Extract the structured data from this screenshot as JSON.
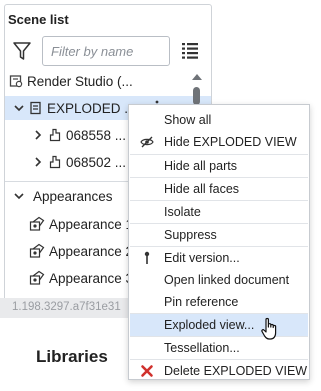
{
  "scene_list": {
    "title": "Scene list",
    "filter_placeholder": "Filter by name",
    "items": [
      {
        "label": "Render Studio (...",
        "icon": "render-studio-icon",
        "level": 0
      },
      {
        "label": "EXPLODED ...",
        "icon": "exploded-view-icon",
        "level": 0,
        "selected": true,
        "expanded": true
      },
      {
        "label": "068558 ...",
        "icon": "part-icon",
        "level": 1
      },
      {
        "label": "068502 ...",
        "icon": "part-icon",
        "level": 1
      }
    ]
  },
  "appearances": {
    "title": "Appearances",
    "items": [
      "Appearance 1",
      "Appearance 2",
      "Appearance 3"
    ]
  },
  "version_text": "1.198.3297.a7f31e31",
  "libraries_title": "Libraries",
  "context_menu": {
    "items": [
      {
        "label": "Show all",
        "icon": ""
      },
      {
        "label": "Hide EXPLODED VIEW",
        "icon": "eye-slash-icon"
      },
      {
        "label": "Hide all parts",
        "icon": ""
      },
      {
        "label": "Hide all faces",
        "icon": ""
      },
      {
        "label": "Isolate",
        "icon": ""
      },
      {
        "label": "Suppress",
        "icon": ""
      },
      {
        "label": "Edit version...",
        "icon": "rollback-marker-icon"
      },
      {
        "label": "Open linked document",
        "icon": ""
      },
      {
        "label": "Pin reference",
        "icon": ""
      },
      {
        "label": "Exploded view...",
        "icon": "",
        "hovered": true
      },
      {
        "label": "Tessellation...",
        "icon": ""
      },
      {
        "label": "Delete EXPLODED VIEW",
        "icon": "delete-x-icon"
      }
    ]
  },
  "colors": {
    "selection": "#d8e7fa",
    "delete_red": "#d0312d",
    "border": "#cfd3d8"
  }
}
